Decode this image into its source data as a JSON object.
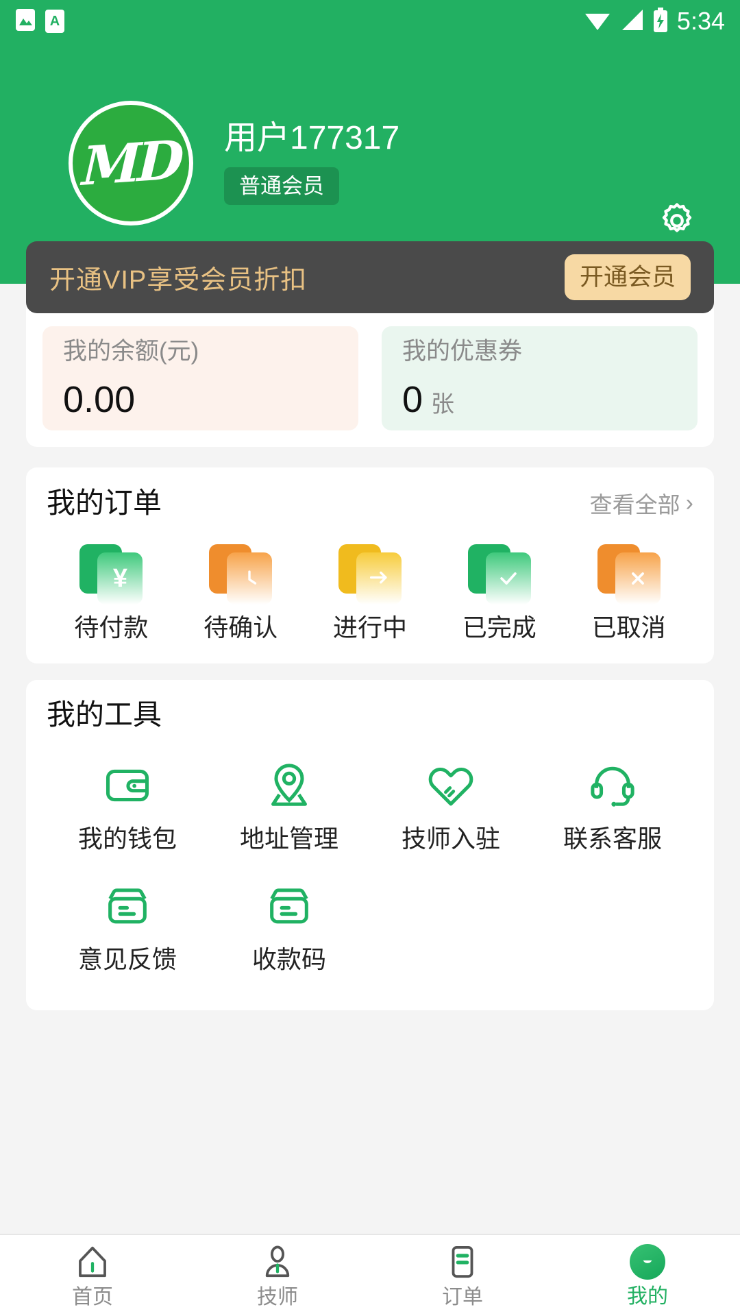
{
  "statusbar": {
    "time": "5:34",
    "icons": [
      "gallery-icon",
      "app-a-icon",
      "wifi-icon",
      "signal-icon",
      "battery-charging-icon"
    ],
    "app_badge_letter": "A"
  },
  "header": {
    "avatar_text": "MD",
    "username": "用户177317",
    "member_badge": "普通会员",
    "settings_icon": "gear-icon",
    "background_color": "#22b062"
  },
  "vip_banner": {
    "text": "开通VIP享受会员折扣",
    "button_label": "开通会员",
    "background_color": "#4a4a4a",
    "text_color": "#e8c183",
    "button_color": "#f7d9a4"
  },
  "stats": {
    "balance": {
      "label": "我的余额(元)",
      "value": "0.00",
      "unit": "",
      "background_color": "#fdf2ec"
    },
    "coupon": {
      "label": "我的优惠券",
      "value": "0",
      "unit": "张",
      "background_color": "#eaf6ef"
    }
  },
  "orders": {
    "title": "我的订单",
    "see_all": "查看全部",
    "chevron": "›",
    "items": [
      {
        "label": "待付款",
        "icon": "yen-stack-icon",
        "glyph": "¥",
        "back_color": "#20b263",
        "front_color": "#3fc97c"
      },
      {
        "label": "待确认",
        "icon": "clock-stack-icon",
        "glyph": "clock",
        "back_color": "#ef8d2d",
        "front_color": "#f7a34a"
      },
      {
        "label": "进行中",
        "icon": "arrow-stack-icon",
        "glyph": "arrow",
        "back_color": "#f0bb1e",
        "front_color": "#f7cc3c"
      },
      {
        "label": "已完成",
        "icon": "check-stack-icon",
        "glyph": "check",
        "back_color": "#20b263",
        "front_color": "#3fc97c"
      },
      {
        "label": "已取消",
        "icon": "cross-stack-icon",
        "glyph": "✕",
        "back_color": "#ef8d2d",
        "front_color": "#f7a34a"
      }
    ]
  },
  "tools": {
    "title": "我的工具",
    "items": [
      {
        "label": "我的钱包",
        "icon": "wallet-icon"
      },
      {
        "label": "地址管理",
        "icon": "location-pin-icon"
      },
      {
        "label": "技师入驻",
        "icon": "heart-hand-icon"
      },
      {
        "label": "联系客服",
        "icon": "headset-icon"
      },
      {
        "label": "意见反馈",
        "icon": "feedback-box-icon"
      },
      {
        "label": "收款码",
        "icon": "payment-code-icon"
      }
    ],
    "icon_color": "#20b263"
  },
  "bottom_nav": {
    "items": [
      {
        "label": "首页",
        "icon": "home-icon",
        "active": false
      },
      {
        "label": "技师",
        "icon": "technician-icon",
        "active": false
      },
      {
        "label": "订单",
        "icon": "order-list-icon",
        "active": false
      },
      {
        "label": "我的",
        "icon": "profile-smile-icon",
        "active": true
      }
    ],
    "active_color": "#22b062",
    "inactive_color": "#8c8c8c"
  }
}
